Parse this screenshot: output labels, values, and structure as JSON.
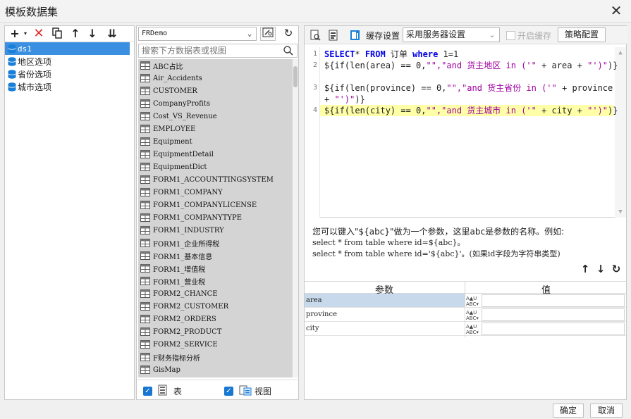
{
  "window": {
    "title": "模板数据集",
    "close_glyph": "✕"
  },
  "left_panel": {
    "toolbar": [
      "add-icon",
      "delete-icon",
      "copy-icon",
      "move-up-icon",
      "move-down-icon",
      "sort-icon"
    ],
    "datasets": [
      {
        "label": "ds1",
        "selected": true
      },
      {
        "label": "地区选项",
        "selected": false
      },
      {
        "label": "省份选项",
        "selected": false
      },
      {
        "label": "城市选项",
        "selected": false
      }
    ]
  },
  "middle_panel": {
    "connection": "FRDemo",
    "search_placeholder": "搜索下方数据表或视图",
    "tables": [
      "ABC占比",
      "Air_Accidents",
      "CUSTOMER",
      "CompanyProfits",
      "Cost_VS_Revenue",
      "EMPLOYEE",
      "Equipment",
      "EquipmentDetail",
      "EquipmentDict",
      "FORM1_ACCOUNTTINGSYSTEM",
      "FORM1_COMPANY",
      "FORM1_COMPANYLICENSE",
      "FORM1_COMPANYTYPE",
      "FORM1_INDUSTRY",
      "FORM1_企业所得税",
      "FORM1_基本信息",
      "FORM1_增值税",
      "FORM1_营业税",
      "FORM2_CHANCE",
      "FORM2_CUSTOMER",
      "FORM2_ORDERS",
      "FORM2_PRODUCT",
      "FORM2_SERVICE",
      "F财务指标分析",
      "GisMap"
    ],
    "show_tables_label": "表",
    "show_views_label": "视图"
  },
  "right_panel": {
    "cache_label": "缓存设置",
    "cache_option": "采用服务器设置",
    "enable_cache_label": "开启缓存",
    "strategy_button": "策略配置",
    "sql_lines": [
      {
        "num": "1",
        "segments": [
          [
            "kw",
            "SELECT"
          ],
          [
            "",
            "*"
          ],
          [
            "kw",
            " FROM"
          ],
          [
            "",
            " 订单 "
          ],
          [
            "kw",
            "where"
          ],
          [
            "",
            " 1=1"
          ]
        ]
      },
      {
        "num": "2",
        "segments": [
          [
            "",
            "${if(len(area) == 0,"
          ],
          [
            "str",
            "\"\",\"and 货主地区 in ('\""
          ],
          [
            "",
            " + area + "
          ],
          [
            "str",
            "\"')\""
          ],
          [
            "",
            ")}"
          ]
        ]
      },
      {
        "num": "3",
        "segments": [
          [
            "",
            "${if(len(province) == 0,"
          ],
          [
            "str",
            "\"\",\"and 货主省份 in ('\""
          ],
          [
            "",
            " + province"
          ]
        ]
      },
      {
        "num": "",
        "segments": [
          [
            "",
            "+ "
          ],
          [
            "str",
            "\"')\""
          ],
          [
            "",
            ")}"
          ]
        ]
      },
      {
        "num": "4",
        "segments": [
          [
            "",
            "${if(len(city) == 0,"
          ],
          [
            "str",
            "\"\",\"and 货主城市 in ('\""
          ],
          [
            "",
            " + city + "
          ],
          [
            "str",
            "\"')\""
          ],
          [
            "",
            ")}"
          ]
        ]
      }
    ],
    "hint_line1": "您可以键入\"${abc}\"做为一个参数，这里abc是参数的名称。例如:",
    "hint_line2": "select * from table where id=${abc}。",
    "hint_line3": "select * from table where id='${abc}'。(如果id字段为字符串类型)",
    "param_header": {
      "name": "参数",
      "value": "值"
    },
    "params": [
      {
        "name": "area",
        "value": "",
        "selected": true
      },
      {
        "name": "province",
        "value": "",
        "selected": false
      },
      {
        "name": "city",
        "value": "",
        "selected": false
      }
    ]
  },
  "footer": {
    "ok": "确定",
    "cancel": "取消"
  }
}
